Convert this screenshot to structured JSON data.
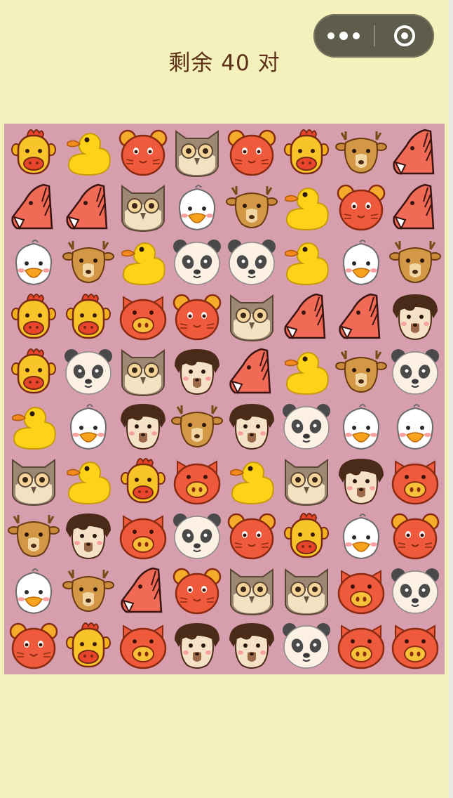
{
  "header": {
    "remaining_label": "剩余 40 对"
  },
  "capsule": {
    "menu_icon": "more-dots-icon",
    "close_icon": "target-circle-icon"
  },
  "colors": {
    "background": "#f4f1bd",
    "board": "#d79fad",
    "title_text": "#5c3018"
  },
  "board": {
    "rows": 10,
    "cols": 8,
    "tiles": [
      [
        "rooster",
        "duck",
        "mouse",
        "owl",
        "mouse",
        "rooster",
        "deer",
        "horse"
      ],
      [
        "horse",
        "horse",
        "owl",
        "chick",
        "deer",
        "duck",
        "mouse",
        "horse"
      ],
      [
        "chick",
        "deer",
        "duck",
        "panda",
        "panda",
        "duck",
        "chick",
        "deer"
      ],
      [
        "rooster",
        "rooster",
        "pig",
        "mouse",
        "owl",
        "horse",
        "horse",
        "dog"
      ],
      [
        "rooster",
        "panda",
        "owl",
        "dog",
        "horse",
        "duck",
        "deer",
        "panda"
      ],
      [
        "duck",
        "chick",
        "dog",
        "deer",
        "dog",
        "panda",
        "chick",
        "chick"
      ],
      [
        "owl",
        "duck",
        "rooster",
        "pig",
        "duck",
        "owl",
        "dog",
        "pig"
      ],
      [
        "deer",
        "dog",
        "pig",
        "panda",
        "mouse",
        "rooster",
        "chick",
        "mouse"
      ],
      [
        "chick",
        "deer",
        "horse",
        "mouse",
        "owl",
        "owl",
        "pig",
        "panda"
      ],
      [
        "mouse",
        "rooster",
        "pig",
        "dog",
        "dog",
        "panda",
        "pig",
        "pig"
      ]
    ]
  }
}
